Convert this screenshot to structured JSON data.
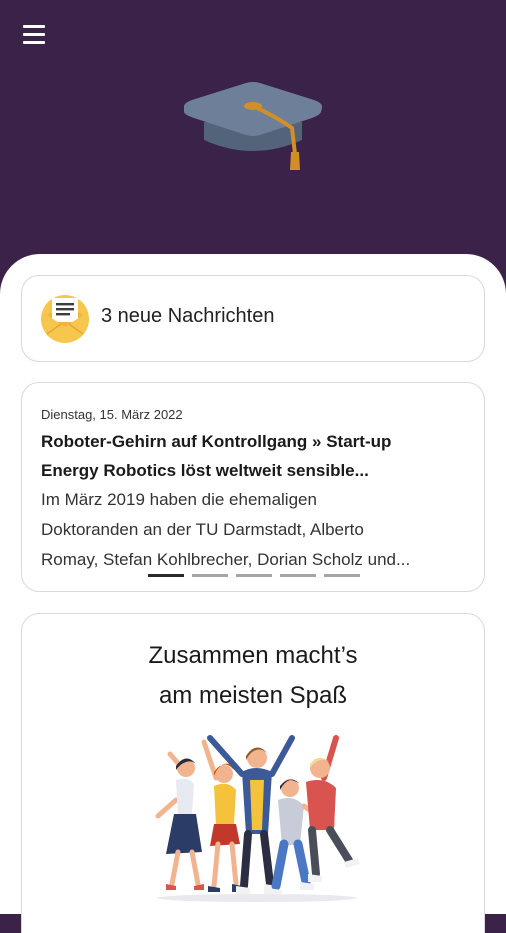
{
  "header": {
    "menu_icon": "hamburger-menu-icon",
    "logo_icon": "graduation-cap-icon",
    "background_color": "#3a2249"
  },
  "messages": {
    "icon": "envelope-icon",
    "label": "3 neue Nachrichten"
  },
  "news": {
    "date": "Dienstag, 15. März 2022",
    "title_lines": [
      "Roboter-Gehirn auf Kontrollgang » Start-up",
      "Energy Robotics löst weltweit sensible..."
    ],
    "excerpt_lines": [
      "Im März 2019 haben die ehemaligen",
      "Doktoranden an der TU Darmstadt, Alberto",
      "Romay, Stefan Kohlbrecher, Dorian Scholz und..."
    ],
    "carousel": {
      "total": 5,
      "active_index": 0
    }
  },
  "promo": {
    "lines": [
      "Zusammen macht’s",
      "am meisten Spaß"
    ],
    "illustration": "group-of-happy-people-illustration"
  }
}
